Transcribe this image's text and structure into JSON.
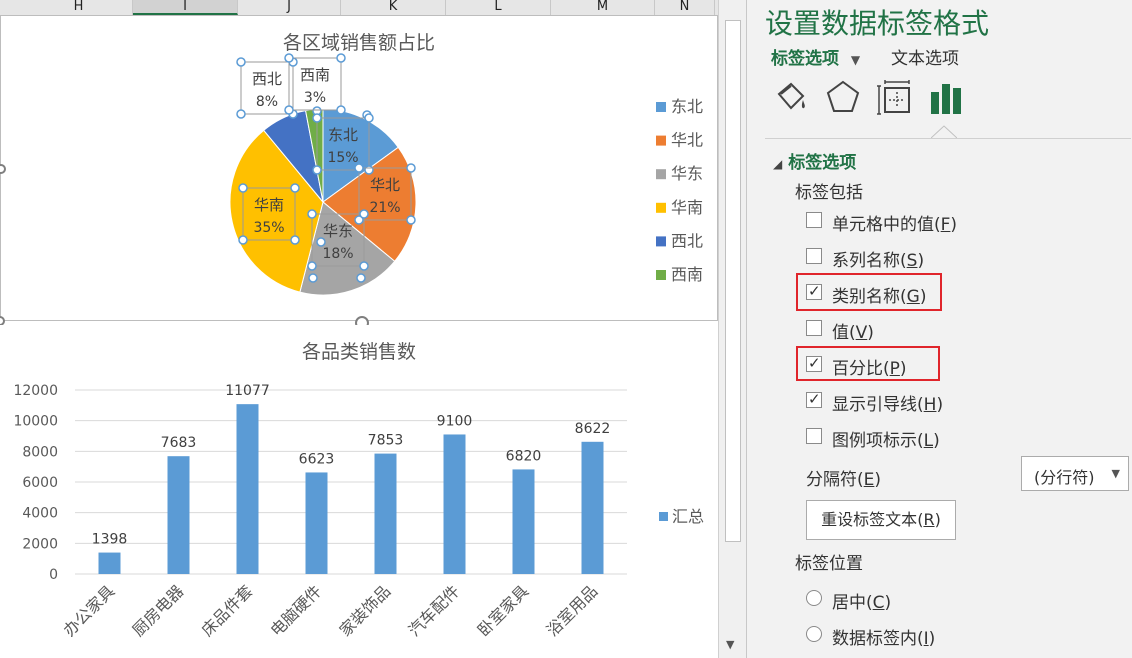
{
  "sheet": {
    "columns": [
      "H",
      "I",
      "J",
      "K",
      "L",
      "M",
      "N"
    ],
    "selected_column": "I"
  },
  "chart_data": [
    {
      "type": "pie",
      "title": "各区域销售额占比",
      "categories": [
        "东北",
        "华北",
        "华东",
        "华南",
        "西北",
        "西南"
      ],
      "values": [
        15,
        21,
        18,
        35,
        8,
        3
      ],
      "unit": "%",
      "colors": [
        "#5b9bd5",
        "#ed7d31",
        "#a5a5a5",
        "#ffc000",
        "#4472c4",
        "#70ad47"
      ],
      "data_labels": [
        {
          "name": "东北",
          "value": "15%"
        },
        {
          "name": "华北",
          "value": "21%"
        },
        {
          "name": "华东",
          "value": "18%"
        },
        {
          "name": "华南",
          "value": "35%"
        },
        {
          "name": "西北",
          "value": "8%"
        },
        {
          "name": "西南",
          "value": "3%"
        }
      ],
      "legend_position": "right"
    },
    {
      "type": "bar",
      "title": "各品类销售数",
      "categories": [
        "办公家具",
        "厨房电器",
        "床品件套",
        "电脑硬件",
        "家装饰品",
        "汽车配件",
        "卧室家具",
        "浴室用品"
      ],
      "series": [
        {
          "name": "汇总",
          "values": [
            1398,
            7683,
            11077,
            6623,
            7853,
            9100,
            6820,
            8622
          ]
        }
      ],
      "ylim": [
        0,
        12000
      ],
      "yticks": [
        0,
        2000,
        4000,
        6000,
        8000,
        10000,
        12000
      ],
      "color": "#5b9bd5",
      "grid": true,
      "legend_position": "right"
    }
  ],
  "panel": {
    "title": "设置数据标签格式",
    "tab_label_options": "标签选项",
    "tab_text_options": "文本选项",
    "icons": [
      "fill-line-icon",
      "effects-icon",
      "size-properties-icon",
      "label-options-icon"
    ],
    "section_label_options": "标签选项",
    "label_contains": "标签包括",
    "checkboxes": [
      {
        "label": "单元格中的值",
        "key": "F",
        "checked": false
      },
      {
        "label": "系列名称",
        "key": "S",
        "checked": false
      },
      {
        "label": "类别名称",
        "key": "G",
        "checked": true
      },
      {
        "label": "值",
        "key": "V",
        "checked": false
      },
      {
        "label": "百分比",
        "key": "P",
        "checked": true
      },
      {
        "label": "显示引导线",
        "key": "H",
        "checked": true
      },
      {
        "label": "图例项标示",
        "key": "L",
        "checked": false
      }
    ],
    "separator_label": "分隔符",
    "separator_key": "E",
    "separator_value": "(分行符)",
    "reset_button": "重设标签文本",
    "reset_key": "R",
    "label_position": "标签位置",
    "radios": [
      {
        "label": "居中",
        "key": "C"
      },
      {
        "label": "数据标签内",
        "key": "I"
      }
    ]
  }
}
